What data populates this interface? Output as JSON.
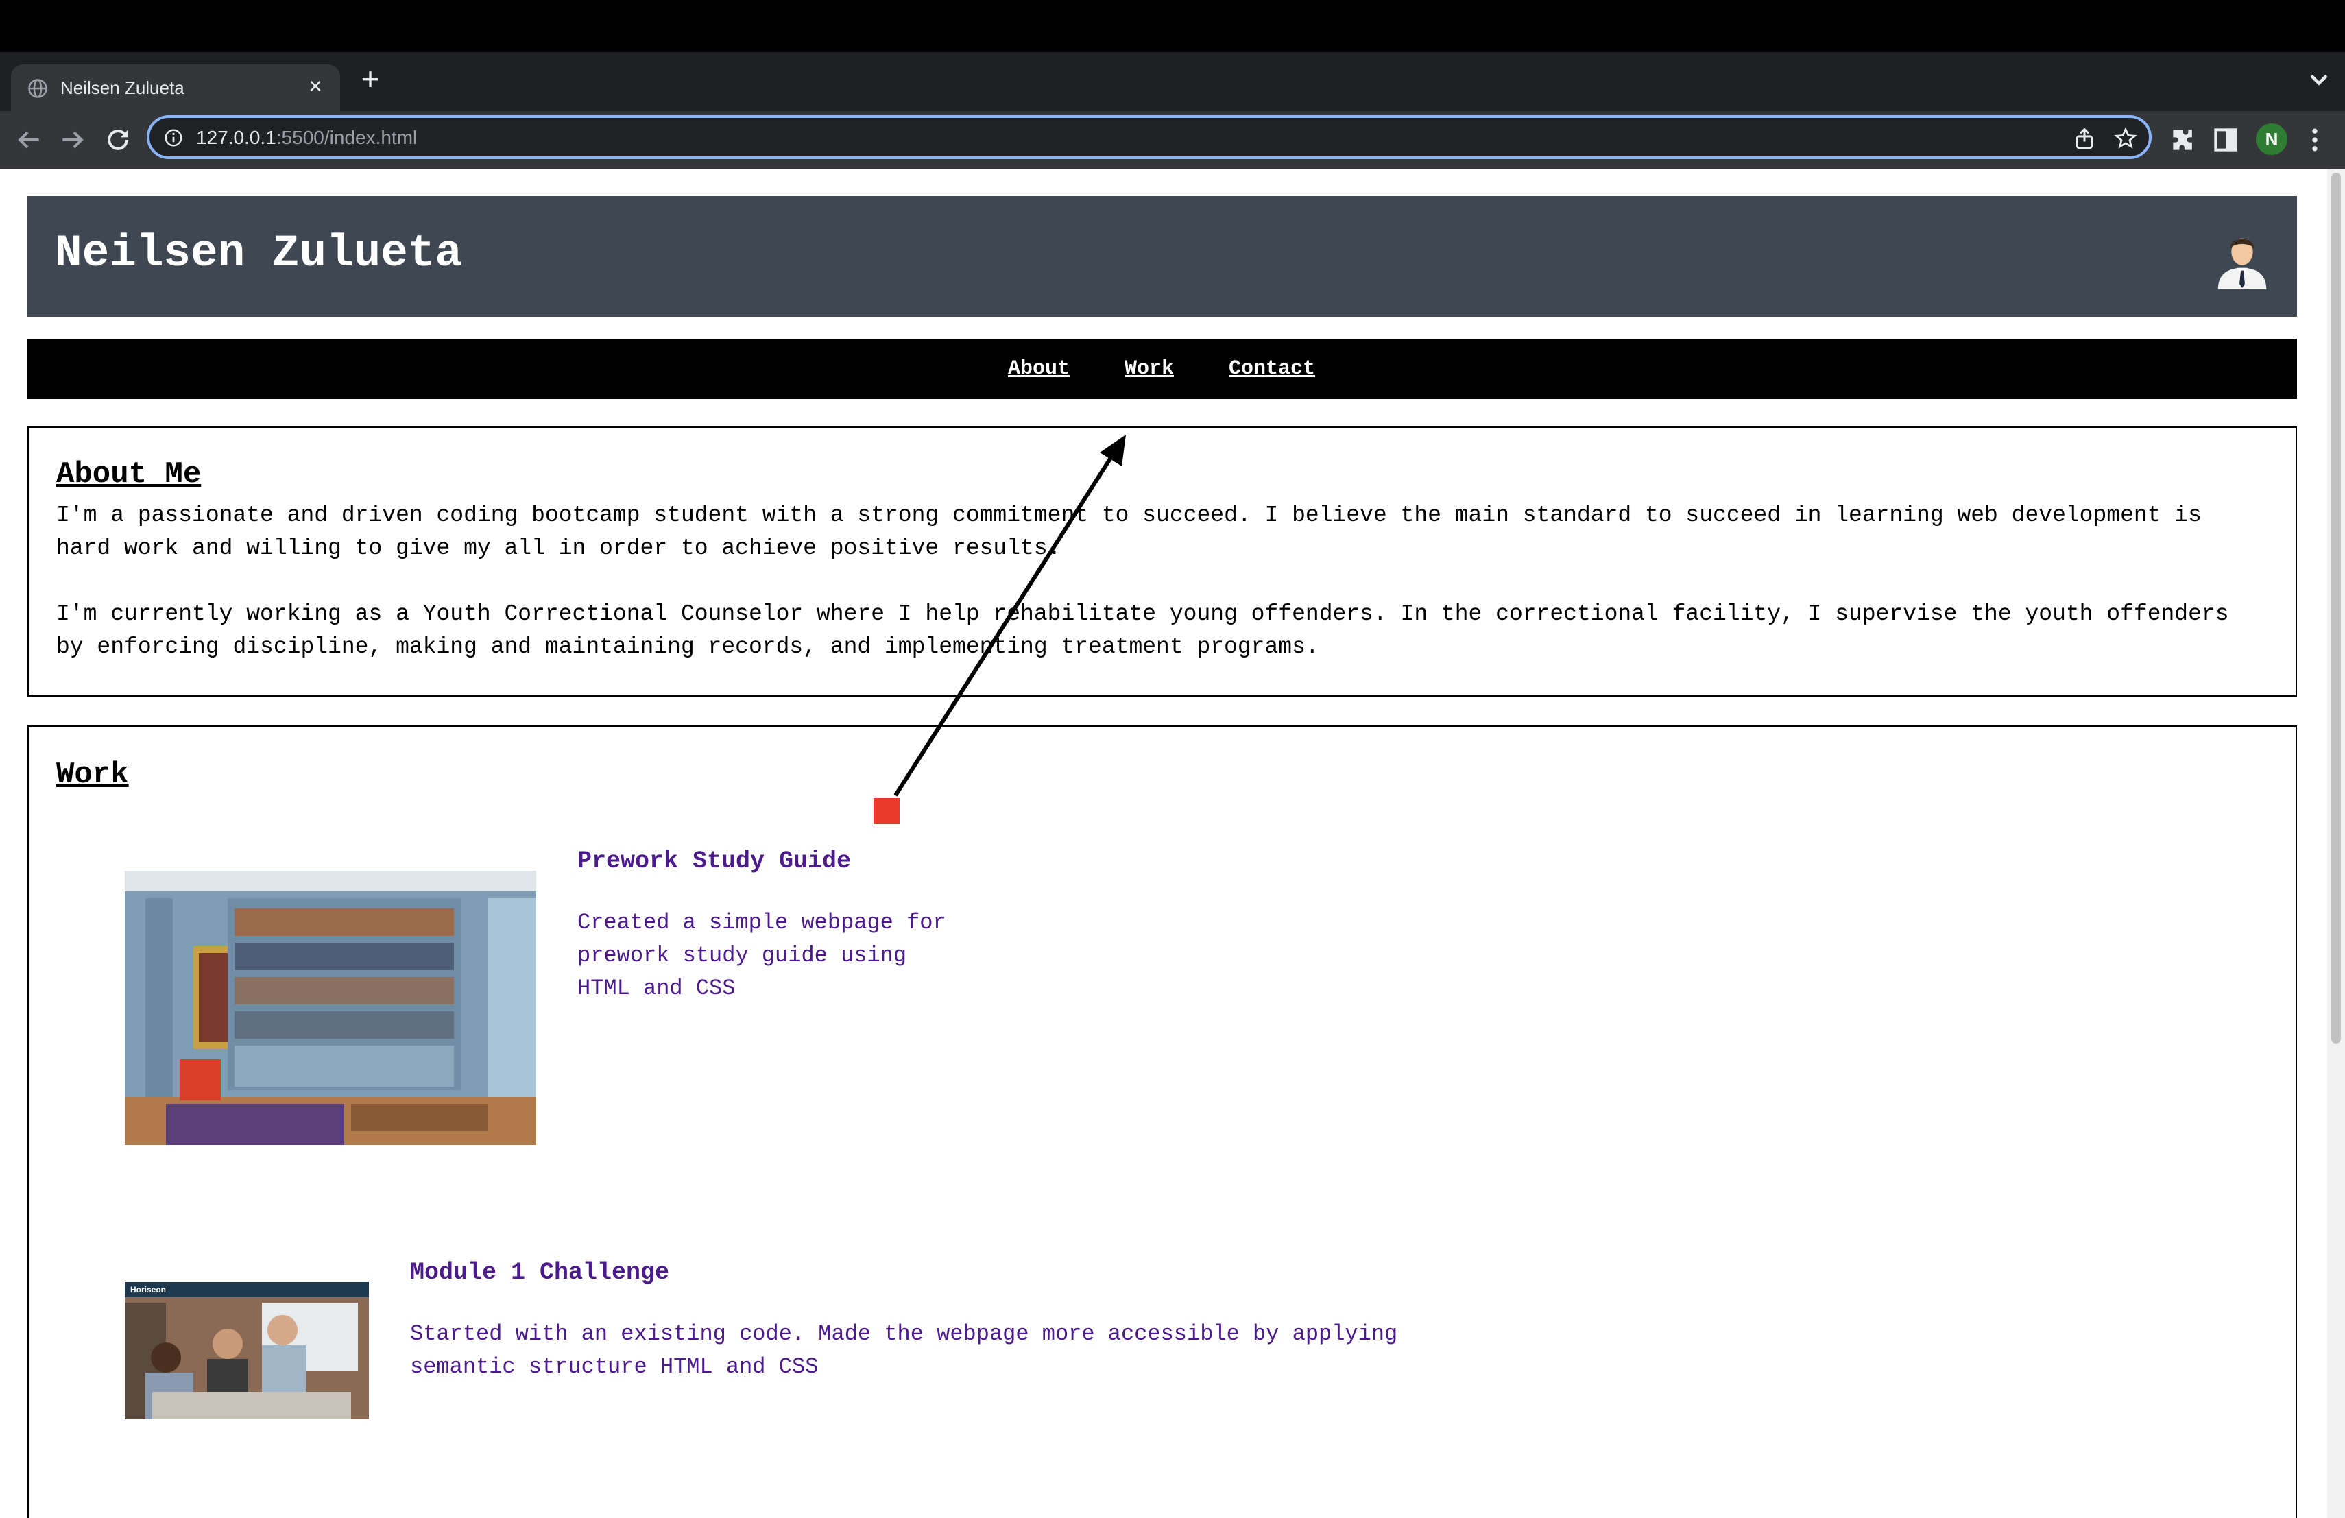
{
  "browser": {
    "tab_title": "Neilsen Zulueta",
    "url_host": "127.0.0.1",
    "url_rest": ":5500/index.html",
    "profile_initial": "N"
  },
  "site": {
    "title": "Neilsen Zulueta",
    "nav": [
      "About",
      "Work",
      "Contact"
    ],
    "about": {
      "heading": "About Me",
      "paragraphs": [
        "I'm a passionate and driven coding bootcamp student with a strong commitment to succeed. I believe the main standard to succeed in learning web development is hard work and willing to give my all in order to achieve positive results.",
        "I'm currently working as a Youth Correctional Counselor where I help rehabilitate young offenders. In the correctional facility, I supervise the youth offenders by enforcing discipline, making and maintaining records, and implementing treatment programs."
      ]
    },
    "work": {
      "heading": "Work",
      "projects": [
        {
          "title": "Prework Study Guide",
          "description": "Created a simple webpage for prework study guide using HTML and CSS"
        },
        {
          "title": "Module 1 Challenge",
          "description": "Started with an existing code. Made the webpage more accessible by applying semantic structure HTML and CSS",
          "thumb_brand": "Horiseon"
        }
      ]
    }
  },
  "colors": {
    "header_bg": "#3f4753",
    "nav_bg": "#000000",
    "project_text": "#4b1a8c",
    "annotation_arrow": "#000000",
    "annotation_marker": "#e8392a"
  },
  "icons": [
    "globe-icon",
    "close-icon",
    "plus-icon",
    "chevron-down-icon",
    "back-icon",
    "forward-icon",
    "reload-icon",
    "info-icon",
    "share-icon",
    "star-icon",
    "puzzle-icon",
    "sidepanel-icon",
    "more-icon",
    "profile-avatar-icon"
  ]
}
